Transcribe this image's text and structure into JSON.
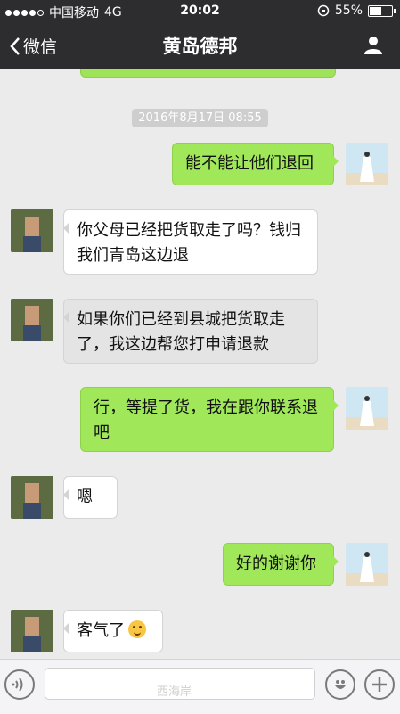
{
  "status_bar": {
    "carrier": "中国移动",
    "network": "4G",
    "time": "20:02",
    "battery": "55%",
    "battery_fraction": 0.55
  },
  "nav": {
    "back_label": "微信",
    "title": "黄岛德邦"
  },
  "chat": {
    "timestamp": "2016年8月17日 08:55",
    "messages": [
      {
        "side": "out",
        "text": "能不能让他们退回"
      },
      {
        "side": "in",
        "text": "你父母已经把货取走了吗？钱归我们青岛这边退"
      },
      {
        "side": "in",
        "text": "如果你们已经到县城把货取走了，我这边帮您打申请退款"
      },
      {
        "side": "out",
        "text": "行，等提了货，我在跟你联系退吧"
      },
      {
        "side": "in",
        "text": "嗯"
      },
      {
        "side": "out",
        "text": "好的谢谢你"
      },
      {
        "side": "in",
        "text": "客气了"
      }
    ]
  },
  "input_bar": {
    "voice_icon": "voice-icon",
    "emoji_icon": "emoji-icon",
    "plus_icon": "plus-icon",
    "watermark": "西海岸"
  },
  "colors": {
    "nav_bg": "#2d2d30",
    "outgoing_bubble": "#a0e75a",
    "chat_bg": "#ebebeb"
  }
}
